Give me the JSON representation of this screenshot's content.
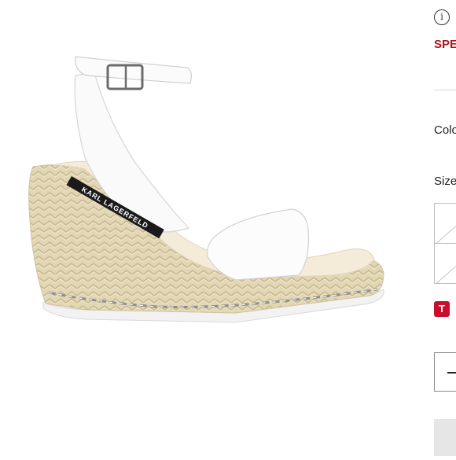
{
  "product": {
    "image_alt": "White ankle-strap espadrille wedge sandal",
    "brand_text": "KARL LAGERFELD"
  },
  "panel": {
    "info_icon_glyph": "i",
    "promo_text": "SPE",
    "color_label": "Colo",
    "size_label": "Size",
    "badge_text": "T",
    "qty_minus_glyph": "−"
  },
  "colors": {
    "promo": "#b0151c",
    "badge": "#c8102e"
  }
}
